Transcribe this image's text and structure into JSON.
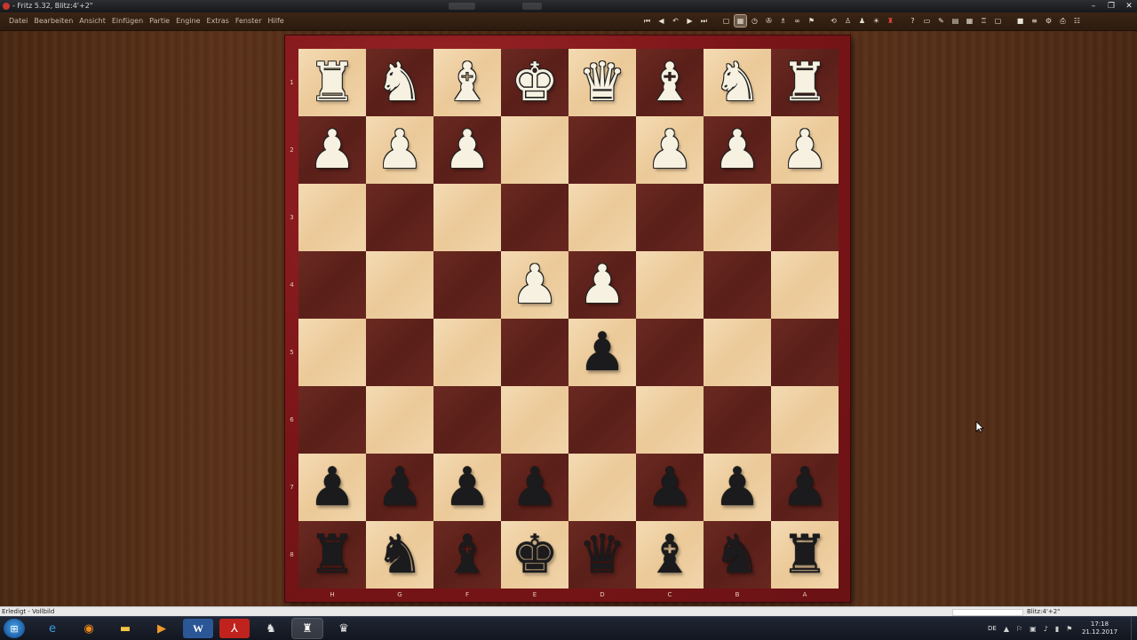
{
  "window": {
    "title": "- Fritz 5.32, Blitz:4'+2\"",
    "controls": [
      "–",
      "❐",
      "✕"
    ]
  },
  "menu": {
    "items": [
      "Datei",
      "Bearbeiten",
      "Ansicht",
      "Einfügen",
      "Partie",
      "Engine",
      "Extras",
      "Fenster",
      "Hilfe"
    ]
  },
  "toolbar": {
    "icons": [
      {
        "name": "first-move-icon",
        "glyph": "⏮"
      },
      {
        "name": "prev-move-icon",
        "glyph": "◀"
      },
      {
        "name": "undo-icon",
        "glyph": "↶"
      },
      {
        "name": "next-move-icon",
        "glyph": "▶"
      },
      {
        "name": "last-move-icon",
        "glyph": "⏭"
      },
      {
        "name": "sep"
      },
      {
        "name": "new-game-icon",
        "glyph": "▢"
      },
      {
        "name": "board-icon",
        "glyph": "▦",
        "active": true
      },
      {
        "name": "clock-icon",
        "glyph": "◷"
      },
      {
        "name": "engine-icon",
        "glyph": "✇"
      },
      {
        "name": "analysis-icon",
        "glyph": "♗"
      },
      {
        "name": "infinite-icon",
        "glyph": "∞"
      },
      {
        "name": "flag-icon",
        "glyph": "⚑"
      },
      {
        "name": "sep"
      },
      {
        "name": "flip-board-icon",
        "glyph": "⟲"
      },
      {
        "name": "piece-set-icon",
        "glyph": "♙"
      },
      {
        "name": "pawn-icon",
        "glyph": "♟"
      },
      {
        "name": "hint-icon",
        "glyph": "☀"
      },
      {
        "name": "book-icon",
        "glyph": "♜",
        "red": true
      },
      {
        "name": "sep"
      },
      {
        "name": "help-icon",
        "glyph": "?"
      },
      {
        "name": "layout-icon",
        "glyph": "▭"
      },
      {
        "name": "edit-icon",
        "glyph": "✎"
      },
      {
        "name": "table-icon",
        "glyph": "▤"
      },
      {
        "name": "grid-icon",
        "glyph": "▦"
      },
      {
        "name": "position-icon",
        "glyph": "♖"
      },
      {
        "name": "window-icon",
        "glyph": "▢"
      },
      {
        "name": "sep"
      },
      {
        "name": "save-icon",
        "glyph": "■"
      },
      {
        "name": "list-icon",
        "glyph": "≡"
      },
      {
        "name": "settings-icon",
        "glyph": "⚙"
      },
      {
        "name": "print-icon",
        "glyph": "⎙"
      },
      {
        "name": "options-icon",
        "glyph": "☷"
      }
    ]
  },
  "board": {
    "ranks": [
      "1",
      "2",
      "3",
      "4",
      "5",
      "6",
      "7",
      "8"
    ],
    "files": [
      "H",
      "G",
      "F",
      "E",
      "D",
      "C",
      "B",
      "A"
    ],
    "position": [
      [
        "wR",
        "wN",
        "wB",
        "wK",
        "wQ",
        "wB",
        "wN",
        "wR"
      ],
      [
        "wP",
        "wP",
        "wP",
        "",
        "",
        "wP",
        "wP",
        "wP"
      ],
      [
        "",
        "",
        "",
        "",
        "",
        "",
        "",
        ""
      ],
      [
        "",
        "",
        "",
        "wP",
        "wP",
        "",
        "",
        ""
      ],
      [
        "",
        "",
        "",
        "",
        "bP",
        "",
        "",
        ""
      ],
      [
        "",
        "",
        "",
        "",
        "",
        "",
        "",
        ""
      ],
      [
        "bP",
        "bP",
        "bP",
        "bP",
        "",
        "bP",
        "bP",
        "bP"
      ],
      [
        "bR",
        "bN",
        "bB",
        "bK",
        "bQ",
        "bB",
        "bN",
        "bR"
      ]
    ]
  },
  "status": {
    "left": "Erledigt - Vollbild",
    "right": "Blitz:4'+2\""
  },
  "taskbar": {
    "apps": [
      {
        "name": "ie-icon",
        "glyph": "e",
        "cls": "ie"
      },
      {
        "name": "firefox-icon",
        "glyph": "◉",
        "cls": "ff"
      },
      {
        "name": "folder-icon",
        "glyph": "▬",
        "cls": "folder"
      },
      {
        "name": "media-player-icon",
        "glyph": "▶",
        "cls": "media"
      },
      {
        "name": "word-icon",
        "glyph": "W",
        "cls": "word"
      },
      {
        "name": "acrobat-icon",
        "glyph": "⅄",
        "cls": "pdf"
      },
      {
        "name": "chess-app-icon",
        "glyph": "♞",
        "cls": "chess1"
      },
      {
        "name": "fritz-icon",
        "glyph": "♜",
        "cls": "chess2",
        "active": true
      },
      {
        "name": "chess-board-app-icon",
        "glyph": "♛",
        "cls": "chess1"
      }
    ],
    "language": "DE",
    "time": "17:18",
    "date": "21.12.2017"
  }
}
